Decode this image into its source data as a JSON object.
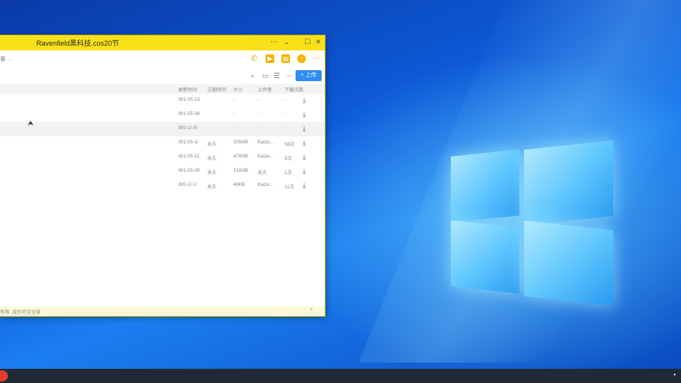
{
  "window": {
    "title": "Ravenfield黑科技.cos20节",
    "controls": {
      "menu": "⋯",
      "chevron": "⌄",
      "restore": "☐",
      "close": "✕"
    }
  },
  "toolbar": {
    "crumb": "量 ...",
    "icons": [
      "phone-icon",
      "video-icon",
      "doc-icon",
      "upload-circle-icon",
      "more-icon"
    ]
  },
  "subbar": {
    "upload_label": "+ 上传"
  },
  "table": {
    "headers": [
      "更新时间",
      "过期时间",
      "大小",
      "上传者",
      "下载次数"
    ],
    "rows": [
      [
        "/8/1-05-13",
        "-",
        "-",
        "-"
      ],
      [
        "/8/1-05-09",
        "-",
        "-",
        "-"
      ],
      [
        "/8/0-1/-/6",
        "-",
        "-",
        "-"
      ],
      [
        "/8/1-05-1/",
        "永久",
        "305MB",
        "Kaize...",
        "58次"
      ],
      [
        "/8/1-05-11",
        "永久",
        "474MB",
        "Kaize...",
        "5次"
      ],
      [
        "/8/1-05-09",
        "永久",
        "151MB",
        "永久",
        "1次"
      ],
      [
        "/8/0-1/-1/",
        "永久",
        "49KB",
        "Kaize...",
        "11次"
      ]
    ]
  },
  "notice": {
    "text": "有限 ,成员可见全部",
    "close": "×"
  },
  "colors": {
    "titlebar": "#f9e11a",
    "accent": "#2f8cf5",
    "desktop": "#0d5bd8"
  }
}
